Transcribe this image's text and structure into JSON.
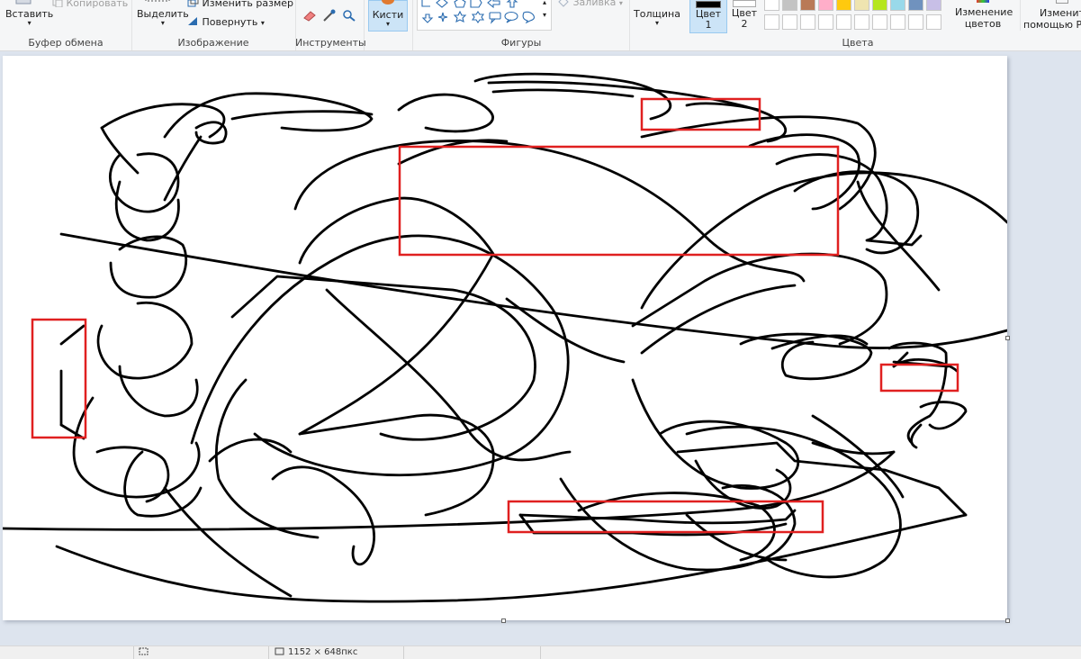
{
  "ribbon": {
    "clipboard": {
      "paste_label": "Вставить",
      "copy_label": "Копировать",
      "group_label": "Буфер обмена"
    },
    "image": {
      "select_label": "Выделить",
      "resize_label": "Изменить размер",
      "rotate_label": "Повернуть",
      "group_label": "Изображение"
    },
    "tools": {
      "group_label": "Инструменты"
    },
    "brushes": {
      "label": "Кисти"
    },
    "shapes": {
      "fill_label": "Заливка",
      "group_label": "Фигуры"
    },
    "thickness": {
      "label": "Толщина"
    },
    "color1": {
      "line1": "Цвет",
      "line2": "1"
    },
    "color2": {
      "line1": "Цвет",
      "line2": "2"
    },
    "colors": {
      "group_label": "Цвета",
      "top_row": [
        "#ffffff",
        "#c3c3c3",
        "#b97a57",
        "#ffaec9",
        "#ffc90e",
        "#efe4b0",
        "#b5e61d",
        "#99d9ea",
        "#7092be",
        "#c8bfe7"
      ],
      "bottom_row": [
        "#ffffff",
        "#ffffff",
        "#ffffff",
        "#ffffff",
        "#ffffff",
        "#ffffff",
        "#ffffff",
        "#ffffff",
        "#ffffff",
        "#ffffff"
      ]
    },
    "edit_colors": {
      "line1": "Изменение",
      "line2": "цветов"
    },
    "paint3d": {
      "line1": "Изменить",
      "line2": "помощью Pa"
    }
  },
  "canvas": {
    "stroke_color": "#000000",
    "highlight_color": "#e02020"
  },
  "statusbar": {
    "size_text": "1152 × 648пкс"
  }
}
